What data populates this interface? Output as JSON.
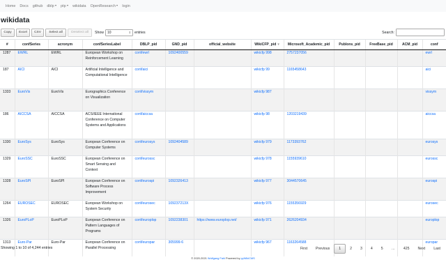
{
  "navbar": {
    "items": [
      {
        "label": "Home",
        "dropdown": false
      },
      {
        "label": "Docs",
        "dropdown": false
      },
      {
        "label": "github",
        "dropdown": false
      },
      {
        "label": "dblp",
        "dropdown": true
      },
      {
        "label": "ptp",
        "dropdown": true
      },
      {
        "label": "wikidata",
        "dropdown": false
      },
      {
        "label": "OpenResearch",
        "dropdown": true
      },
      {
        "label": "login",
        "dropdown": false
      }
    ]
  },
  "page_title": "wikidata",
  "toolbar": {
    "copy_label": "Copy",
    "excel_label": "Excel",
    "csv_label": "CSV",
    "select_all_label": "Select all",
    "deselect_all_label": "Deselect all",
    "show_label": "Show",
    "length_value": "10",
    "entries_label": "entries",
    "search_label": "Search:",
    "search_value": ""
  },
  "table": {
    "columns": [
      "#",
      "confSeries",
      "acronym",
      "confSeriesLabel",
      "DBLP_pid",
      "GND_pid",
      "official_website",
      "WikiCFP_pid",
      "Microsoft_Academic_pid",
      "Publons_pid",
      "FreeBase_pid",
      "ACM_pid",
      "conf"
    ],
    "sorted_column_indicator": "▼",
    "rows": [
      {
        "num": "1287",
        "confSeries": "EWRL",
        "acronym": "EWRL",
        "label": "European Workshop on Reinforcement Learning",
        "dblp": "conf/ewrl",
        "gnd": "1092400559",
        "website": "",
        "wikicfp": "wikicfp 998",
        "msa": "2757237056",
        "publons": "",
        "freebase": "",
        "acm": "",
        "conf": "ewrl"
      },
      {
        "num": "187",
        "confSeries": "AICI",
        "acronym": "AICI",
        "label": "Artificial Intelligence and Computational Intelligence",
        "dblp": "conf/aici",
        "gnd": "",
        "website": "",
        "wikicfp": "wikicfp 99",
        "msa": "1165458643",
        "publons": "",
        "freebase": "",
        "acm": "",
        "conf": "aici"
      },
      {
        "num": "1333",
        "confSeries": "EuroVis",
        "acronym": "EuroVis",
        "label": "Eurographics Conference on Visualization",
        "dblp": "conf/vissym",
        "gnd": "",
        "website": "",
        "wikicfp": "wikicfp 987",
        "msa": "",
        "publons": "",
        "freebase": "",
        "acm": "",
        "conf": "vissym"
      },
      {
        "num": "186",
        "confSeries": "AICCSA",
        "acronym": "AICCSA",
        "label": "ACS/IEEE International Conference on Computer Systems and Applications",
        "dblp": "conf/aiccsa",
        "gnd": "",
        "website": "",
        "wikicfp": "wikicfp 98",
        "msa": "1203219439",
        "publons": "",
        "freebase": "",
        "acm": "",
        "conf": "aiccsa"
      },
      {
        "num": "1330",
        "confSeries": "EuroSys",
        "acronym": "EuroSys",
        "label": "European Conference on Computer Systems",
        "dblp": "conf/eurosys",
        "gnd": "1092404589",
        "website": "",
        "wikicfp": "wikicfp 979",
        "msa": "1173393762",
        "publons": "",
        "freebase": "",
        "acm": "",
        "conf": "eurosys"
      },
      {
        "num": "1329",
        "confSeries": "EuroSSC",
        "acronym": "EuroSSC",
        "label": "European Conference on Smart Sensing and Context",
        "dblp": "conf/eurossc",
        "gnd": "",
        "website": "",
        "wikicfp": "wikicfp 978",
        "msa": "1155939610",
        "publons": "",
        "freebase": "",
        "acm": "",
        "conf": "eurossc"
      },
      {
        "num": "1328",
        "confSeries": "EuroSPI",
        "acronym": "EuroSPI",
        "label": "European Conference on Software Process Improvement",
        "dblp": "conf/eurospi",
        "gnd": "1092326413",
        "website": "",
        "wikicfp": "wikicfp 977",
        "msa": "3044570645",
        "publons": "",
        "freebase": "",
        "acm": "",
        "conf": "eurospi"
      },
      {
        "num": "1264",
        "confSeries": "EUROSEC",
        "acronym": "EUROSEC",
        "label": "European Workshop on System Security",
        "dblp": "conf/eurosec",
        "gnd": "109237213X",
        "website": "",
        "wikicfp": "wikicfp 976",
        "msa": "1155356929",
        "publons": "",
        "freebase": "",
        "acm": "",
        "conf": "eurosec"
      },
      {
        "num": "1326",
        "confSeries": "EuroPLoP",
        "acronym": "EuroPLoP",
        "label": "European Conference on Pattern Languages of Programs",
        "dblp": "conf/europlop",
        "gnd": "1092238301",
        "website": "https://www.europlop.net/",
        "wikicfp": "wikicfp 971",
        "msa": "2626204934",
        "publons": "",
        "freebase": "",
        "acm": "",
        "conf": "europlop"
      },
      {
        "num": "1313",
        "confSeries": "Euro-Par",
        "acronym": "Euro-Par",
        "label": "European Conference on Parallel Processing",
        "dblp": "conf/europar",
        "gnd": "305999-6",
        "website": "",
        "wikicfp": "wikicfp 967",
        "msa": "1163264588",
        "publons": "",
        "freebase": "",
        "acm": "",
        "conf": "europar"
      }
    ]
  },
  "info": "Showing 1 to 10 of 4,244 entries",
  "pagination": {
    "first": "First",
    "previous": "Previous",
    "pages": [
      "1",
      "2",
      "3",
      "4",
      "5",
      "…",
      "425"
    ],
    "current": "1",
    "next": "Next",
    "last": "Last"
  },
  "footer": {
    "prefix": "© 2020-2021",
    "author": "Wolfgang Fahl",
    "middle": "Powered by",
    "powered": "pyWikiCMS"
  }
}
